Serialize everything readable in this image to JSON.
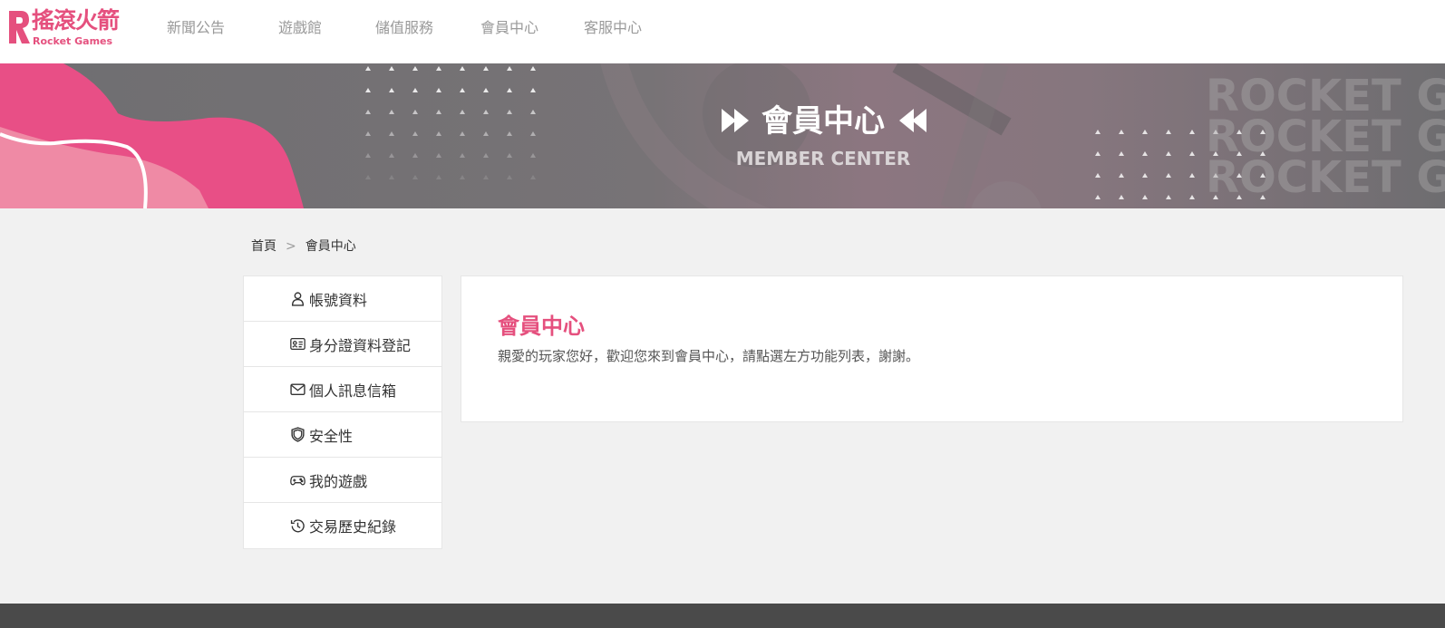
{
  "header": {
    "logo_cn": "搖滾火箭",
    "logo_en": "Rocket Games",
    "nav": [
      {
        "label": "新聞公告",
        "name": "nav-news"
      },
      {
        "label": "遊戲館",
        "name": "nav-games"
      },
      {
        "label": "儲值服務",
        "name": "nav-topup"
      },
      {
        "label": "會員中心",
        "name": "nav-member"
      },
      {
        "label": "客服中心",
        "name": "nav-support"
      }
    ]
  },
  "banner": {
    "title": "會員中心",
    "subtitle": "MEMBER CENTER",
    "watermark": "ROCKET G"
  },
  "breadcrumb": {
    "home": "首頁",
    "separator": ">",
    "current": "會員中心"
  },
  "sidebar": {
    "items": [
      {
        "label": "帳號資料",
        "icon": "user-icon"
      },
      {
        "label": "身分證資料登記",
        "icon": "id-card-icon"
      },
      {
        "label": "個人訊息信箱",
        "icon": "envelope-icon"
      },
      {
        "label": "安全性",
        "icon": "shield-icon"
      },
      {
        "label": "我的遊戲",
        "icon": "gamepad-icon"
      },
      {
        "label": "交易歷史紀錄",
        "icon": "history-icon"
      }
    ]
  },
  "main": {
    "title": "會員中心",
    "text": "親愛的玩家您好，歡迎您來到會員中心，請點選左方功能列表，謝謝。"
  },
  "colors": {
    "brand": "#e5507e",
    "banner_gray": "#777376",
    "footer": "#4a4a4a"
  }
}
